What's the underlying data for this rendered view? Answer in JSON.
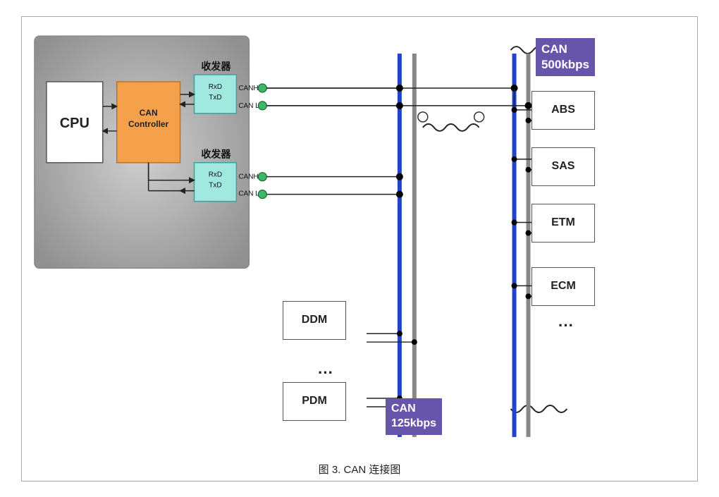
{
  "diagram": {
    "caption": "图 3.    CAN 连接图",
    "ecu": {
      "cpu_label": "CPU",
      "controller_label": "CAN\nController",
      "transceiver1_label": "收发器",
      "transceiver2_label": "收发器",
      "rxd": "RxD",
      "txd": "TxD"
    },
    "can_badges": {
      "high_speed": "CAN\n500kbps",
      "low_speed": "CAN\n125kbps"
    },
    "devices": [
      "ABS",
      "SAS",
      "ETM",
      "ECM",
      "..."
    ],
    "bottom_devices": [
      "DDM",
      "...",
      "PDM"
    ]
  }
}
